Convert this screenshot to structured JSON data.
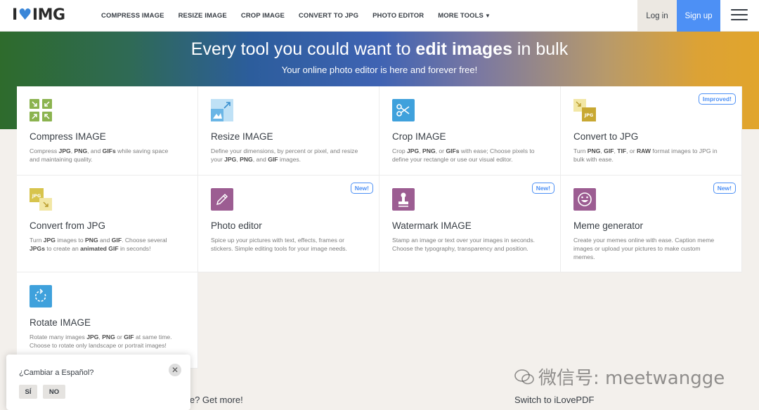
{
  "header": {
    "logo_left": "I",
    "logo_right": "IMG",
    "nav": [
      "COMPRESS IMAGE",
      "RESIZE IMAGE",
      "CROP IMAGE",
      "CONVERT TO JPG",
      "PHOTO EDITOR",
      "MORE TOOLS"
    ],
    "login": "Log in",
    "signup": "Sign up"
  },
  "hero": {
    "title_pre": "Every tool you could want to ",
    "title_bold": "edit images",
    "title_post": " in bulk",
    "subtitle": "Your online photo editor is here and forever free!"
  },
  "tools": [
    {
      "title": "Compress IMAGE",
      "desc": "Compress JPG, PNG, and GIFs while saving space and maintaining quality.",
      "icon": "compress-icon",
      "color": "#8bb34f",
      "badge": ""
    },
    {
      "title": "Resize IMAGE",
      "desc": "Define your dimensions, by percent or pixel, and resize your JPG, PNG, and GIF images.",
      "icon": "resize-icon",
      "color": "#6bb6e6",
      "badge": ""
    },
    {
      "title": "Crop IMAGE",
      "desc": "Crop JPG, PNG, or GIFs with ease; Choose pixels to define your rectangle or use our visual editor.",
      "icon": "scissors-icon",
      "color": "#3fa1dc",
      "badge": ""
    },
    {
      "title": "Convert to JPG",
      "desc": "Turn PNG, GIF, TIF, or RAW format images to JPG in bulk with ease.",
      "icon": "convert-to-jpg-icon",
      "color": "#d7c44d",
      "badge": "Improved!"
    },
    {
      "title": "Convert from JPG",
      "desc": "Turn JPG images to PNG and GIF. Choose several JPGs to create an animated GIF in seconds!",
      "icon": "convert-from-jpg-icon",
      "color": "#e2cf58",
      "badge": ""
    },
    {
      "title": "Photo editor",
      "desc": "Spice up your pictures with text, effects, frames or stickers. Simple editing tools for your image needs.",
      "icon": "pencil-icon",
      "color": "#9c5d92",
      "badge": "New!"
    },
    {
      "title": "Watermark IMAGE",
      "desc": "Stamp an image or text over your images in seconds. Choose the typography, transparency and position.",
      "icon": "stamp-icon",
      "color": "#9c5d92",
      "badge": "New!"
    },
    {
      "title": "Meme generator",
      "desc": "Create your memes online with ease. Caption meme images or upload your pictures to make custom memes.",
      "icon": "smiley-icon",
      "color": "#9c5d92",
      "badge": "New!"
    },
    {
      "title": "Rotate IMAGE",
      "desc": "Rotate many images JPG, PNG or GIF at same time. Choose to rotate only landscape or portrait images!",
      "icon": "rotate-icon",
      "color": "#3fa1dc",
      "badge": ""
    }
  ],
  "bottom": {
    "want_more": "Want more? Get more!",
    "switch": "Switch to iLovePDF"
  },
  "popup": {
    "question": "¿Cambiar a Español?",
    "yes": "SÍ",
    "no": "NO"
  },
  "watermark": "微信号: meetwangge"
}
